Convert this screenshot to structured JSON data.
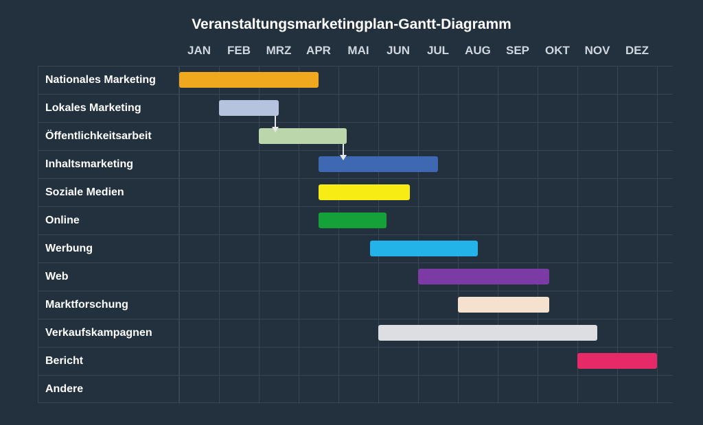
{
  "chart_data": {
    "type": "gantt",
    "title": "Veranstaltungsmarketingplan-Gantt-Diagramm",
    "months": [
      "JAN",
      "FEB",
      "MRZ",
      "APR",
      "MAI",
      "JUN",
      "JUL",
      "AUG",
      "SEP",
      "OKT",
      "NOV",
      "DEZ"
    ],
    "tasks": [
      {
        "name": "Nationales Marketing",
        "start": 0.0,
        "end": 3.5,
        "color": "#f0a81f"
      },
      {
        "name": "Lokales Marketing",
        "start": 1.0,
        "end": 2.5,
        "color": "#b6c3df"
      },
      {
        "name": "Öffentlichkeitsarbeit",
        "start": 2.0,
        "end": 4.2,
        "color": "#bcd6ab"
      },
      {
        "name": "Inhaltsmarketing",
        "start": 3.5,
        "end": 6.5,
        "color": "#3e68b2"
      },
      {
        "name": "Soziale Medien",
        "start": 3.5,
        "end": 5.8,
        "color": "#f7ec13"
      },
      {
        "name": "Online",
        "start": 3.5,
        "end": 5.2,
        "color": "#14a139"
      },
      {
        "name": "Werbung",
        "start": 4.8,
        "end": 7.5,
        "color": "#23b3e8"
      },
      {
        "name": "Web",
        "start": 6.0,
        "end": 9.3,
        "color": "#7b3aa4"
      },
      {
        "name": "Marktforschung",
        "start": 7.0,
        "end": 9.3,
        "color": "#f6e0ce"
      },
      {
        "name": "Verkaufskampagnen",
        "start": 5.0,
        "end": 10.5,
        "color": "#dddee1"
      },
      {
        "name": "Bericht",
        "start": 10.0,
        "end": 12.0,
        "color": "#e62a67"
      },
      {
        "name": "Andere",
        "start": null,
        "end": null,
        "color": null
      }
    ],
    "dependencies": [
      {
        "from_task": 1,
        "to_task": 2
      },
      {
        "from_task": 2,
        "to_task": 3
      }
    ]
  }
}
